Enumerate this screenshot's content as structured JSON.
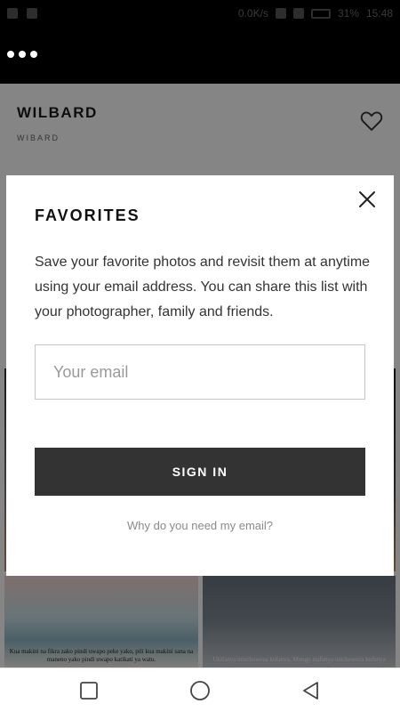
{
  "status_bar": {
    "speed": "0.0K/s",
    "battery": "31%",
    "time": "15:48"
  },
  "gallery": {
    "title": "WILBARD",
    "subtitle": "WIBARD",
    "captions": [
      "Kua makini na fikra zako pindi uwapo peke yako, pili kua makini sana na maneno yako pindi uwapo katikati ya watu.",
      "Ukifanya unachoweza kufanya, Mungu atafanya usichoweza kufanya"
    ]
  },
  "modal": {
    "title": "FAVORITES",
    "description": "Save your favorite photos and revisit them at anytime using your email address. You can share this list with your photographer, family and friends.",
    "email_placeholder": "Your email",
    "email_value": "",
    "signin_label": "SIGN IN",
    "why_link": "Why do you need my email?"
  },
  "icons": {
    "menu": "more-dots-icon",
    "favorite": "heart-icon",
    "close": "close-icon",
    "nav": [
      "recents-square-icon",
      "home-circle-icon",
      "back-triangle-icon"
    ]
  },
  "colors": {
    "button_bg": "#333333",
    "overlay": "rgba(0,0,0,0.48)"
  }
}
